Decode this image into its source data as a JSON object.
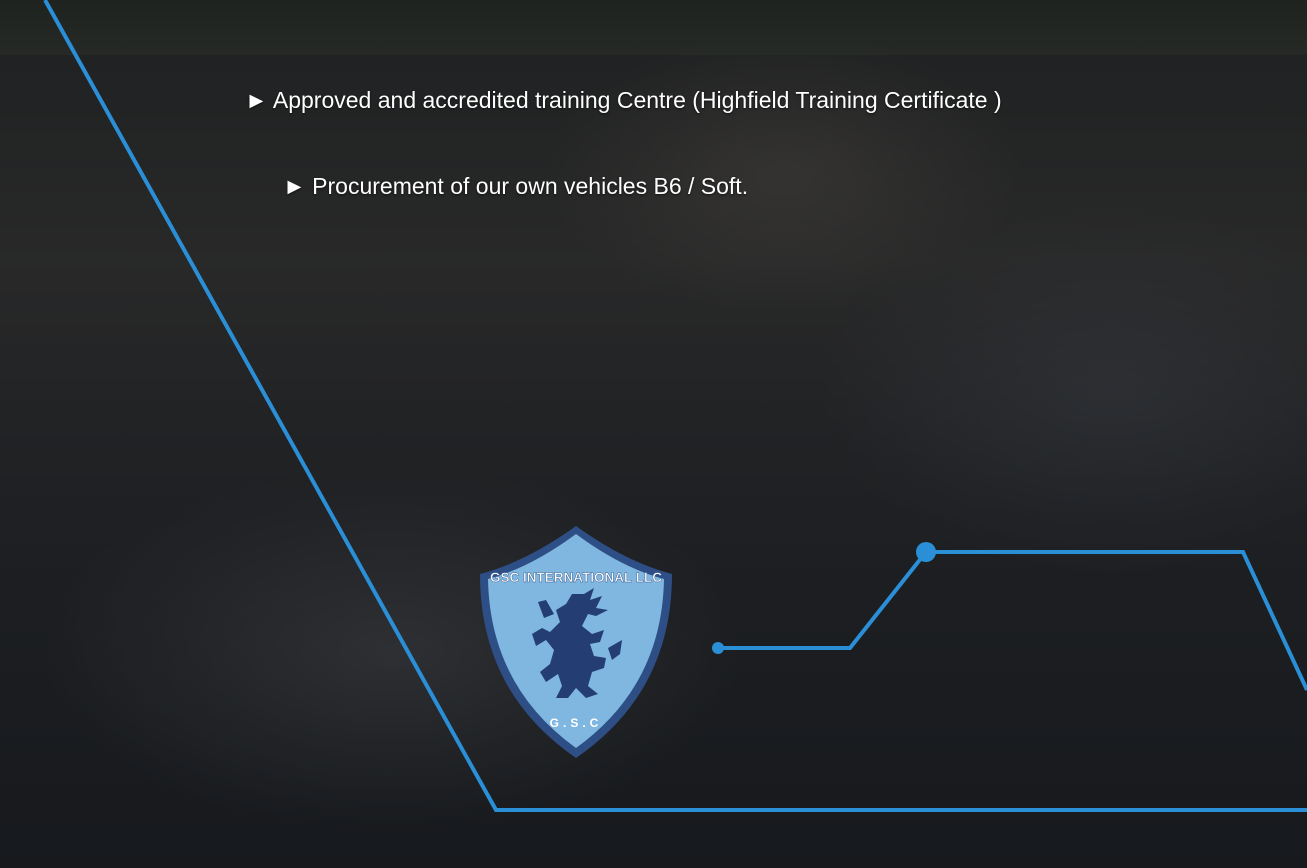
{
  "bullets": [
    "► Approved and accredited training Centre (Highfield Training Certificate )",
    "► Procurement of our own vehicles B6 / Soft."
  ],
  "logo": {
    "top_text": "GSC INTERNATIONAL LLC",
    "bottom_text": "G.S.C",
    "icon": "lion-rampant-icon"
  },
  "colors": {
    "accent_line": "#2a8fd6",
    "crest_fill": "#7fb7e0",
    "crest_border": "#2e4f86",
    "lion": "#243e73"
  }
}
